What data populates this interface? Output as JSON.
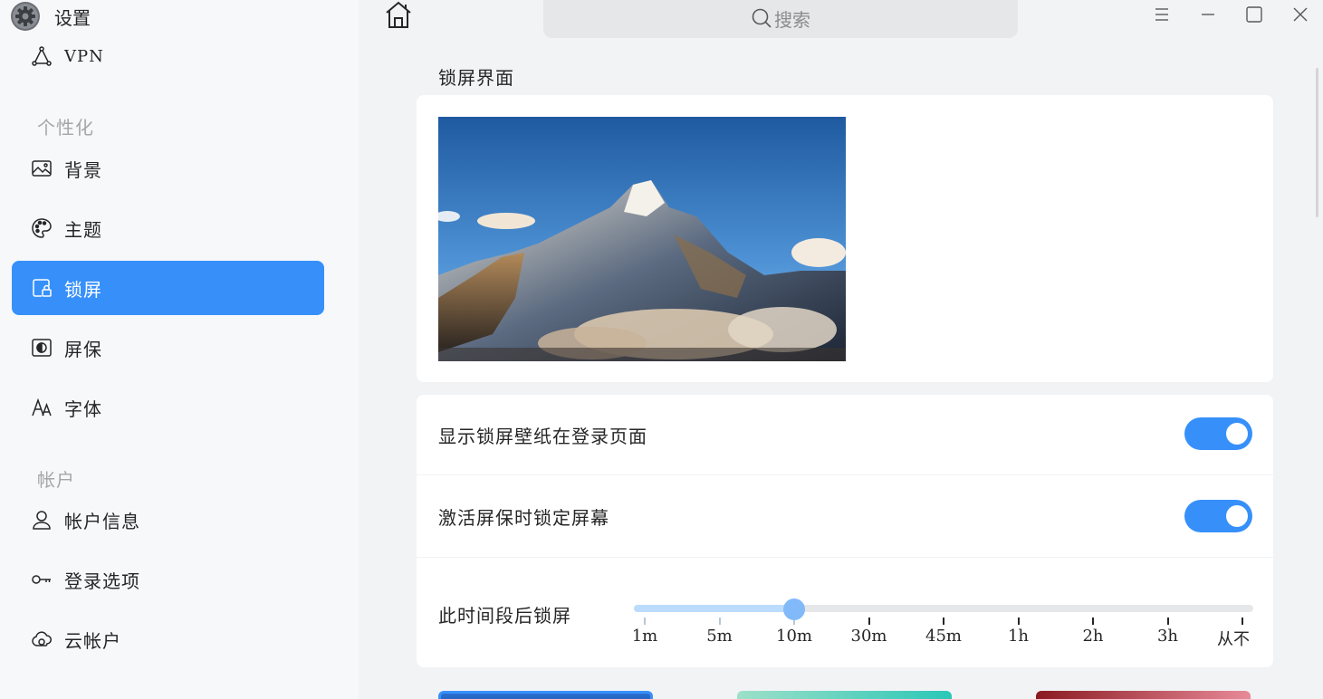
{
  "app": {
    "title": "设置"
  },
  "sidebar": {
    "vpn": {
      "label": "VPN",
      "icon": "vpn-icon"
    },
    "section_personalize": "个性化",
    "personalize_items": [
      {
        "label": "背景",
        "icon": "image-icon"
      },
      {
        "label": "主题",
        "icon": "palette-icon"
      },
      {
        "label": "锁屏",
        "icon": "lockscreen-icon",
        "active": true
      },
      {
        "label": "屏保",
        "icon": "screensaver-icon"
      },
      {
        "label": "字体",
        "icon": "font-icon"
      }
    ],
    "section_account": "帐户",
    "account_items": [
      {
        "label": "帐户信息",
        "icon": "user-icon"
      },
      {
        "label": "登录选项",
        "icon": "key-icon"
      },
      {
        "label": "云帐户",
        "icon": "cloud-icon"
      }
    ]
  },
  "header": {
    "search_placeholder": "搜索"
  },
  "main": {
    "section_title": "锁屏界面",
    "settings": [
      {
        "label": "显示锁屏壁纸在登录页面",
        "enabled": true
      },
      {
        "label": "激活屏保时锁定屏幕",
        "enabled": true
      }
    ],
    "lock_after": {
      "label": "此时间段后锁屏",
      "options": [
        "1m",
        "5m",
        "10m",
        "30m",
        "45m",
        "1h",
        "2h",
        "3h",
        "从不"
      ],
      "selected": "10m"
    }
  },
  "colors": {
    "accent": "#3790fa",
    "sidebar_bg": "#f7f8fa",
    "main_bg": "#f2f3f5"
  }
}
